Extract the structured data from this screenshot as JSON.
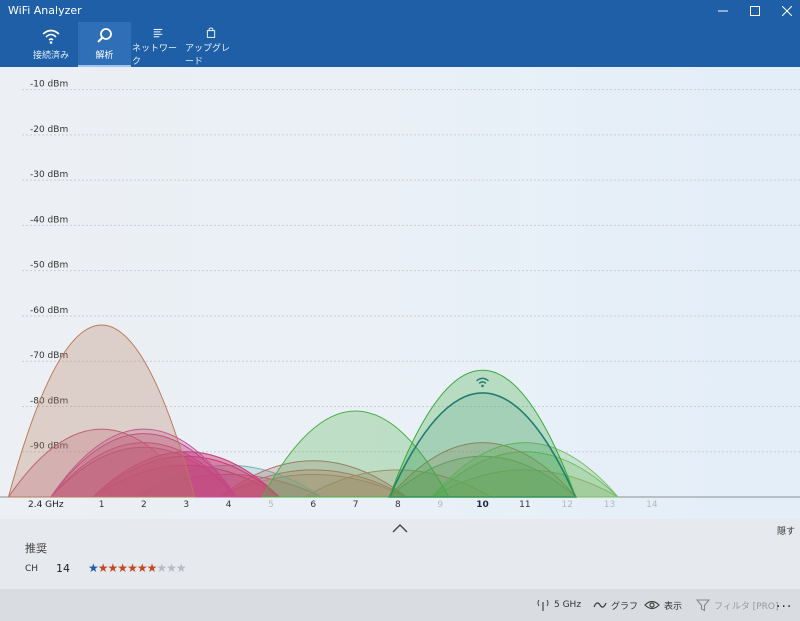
{
  "window": {
    "title": "WiFi Analyzer"
  },
  "nav": {
    "tabs": [
      {
        "label": "接続済み",
        "icon": "wifi-icon"
      },
      {
        "label": "解析",
        "icon": "magnifier-icon"
      },
      {
        "label": "ネットワーク",
        "icon": "network-list-icon"
      },
      {
        "label": "アップグレード",
        "icon": "shopping-bag-icon"
      }
    ],
    "active_index": 1
  },
  "chart_data": {
    "type": "area",
    "band": "2.4 GHz",
    "y_axis": {
      "ticks": [
        "-10 dBm",
        "-20 dBm",
        "-30 dBm",
        "-40 dBm",
        "-50 dBm",
        "-60 dBm",
        "-70 dBm",
        "-80 dBm",
        "-90 dBm"
      ],
      "tick_values": [
        -10,
        -20,
        -30,
        -40,
        -50,
        -60,
        -70,
        -80,
        -90
      ],
      "range": [
        -100,
        -5
      ],
      "grid": true
    },
    "x_axis": {
      "channels": [
        "1",
        "2",
        "3",
        "4",
        "5",
        "6",
        "7",
        "8",
        "9",
        "10",
        "11",
        "12",
        "13",
        "14"
      ],
      "channel_values": [
        1,
        2,
        3,
        4,
        5,
        6,
        7,
        8,
        9,
        10,
        11,
        12,
        13,
        14
      ],
      "dim_channels": [
        5,
        9,
        12,
        13,
        14
      ],
      "bold_channels": [
        10
      ],
      "range": [
        -1.4,
        17.5
      ]
    },
    "networks": [
      {
        "channel": 1,
        "level": -62,
        "color": "#b87b5a"
      },
      {
        "channel": 1,
        "level": -85,
        "color": "#c2587a"
      },
      {
        "channel": 2,
        "level": -85,
        "color": "#c4509a"
      },
      {
        "channel": 2,
        "level": -86,
        "color": "#c0407a"
      },
      {
        "channel": 2,
        "level": -88,
        "color": "#c84470"
      },
      {
        "channel": 2,
        "level": -89,
        "color": "#c64878"
      },
      {
        "channel": 3,
        "level": -90,
        "color": "#c83c64"
      },
      {
        "channel": 3,
        "level": -91,
        "color": "#cc3860"
      },
      {
        "channel": 3,
        "level": -93,
        "color": "#c03858"
      },
      {
        "channel": 3,
        "level": -90,
        "color": "#c84488"
      },
      {
        "channel": 4,
        "level": -93,
        "color": "#7ab8b0"
      },
      {
        "channel": 4,
        "level": -95,
        "color": "#c8507a"
      },
      {
        "channel": 6,
        "level": -92,
        "color": "#b07070"
      },
      {
        "channel": 6,
        "level": -94,
        "color": "#c06a60"
      },
      {
        "channel": 6,
        "level": -95,
        "color": "#d07c6a"
      },
      {
        "channel": 7,
        "level": -81,
        "color": "#4cb048"
      },
      {
        "channel": 8,
        "level": -94,
        "color": "#b88a70"
      },
      {
        "channel": 10,
        "level": -72,
        "color": "#3aa83a"
      },
      {
        "channel": 10,
        "level": -77,
        "color": "#1a6e86",
        "connected": true
      },
      {
        "channel": 10,
        "level": -88,
        "color": "#b27c60"
      },
      {
        "channel": 10,
        "level": -91,
        "color": "#60b060"
      },
      {
        "channel": 11,
        "level": -88,
        "color": "#78c068"
      },
      {
        "channel": 11,
        "level": -90,
        "color": "#70c060"
      },
      {
        "channel": 11,
        "level": -94,
        "color": "#90a870"
      }
    ]
  },
  "panel": {
    "hide_label": "隠す",
    "title": "推奨",
    "ch_label": "CH",
    "ch_value": "14",
    "rating": 7,
    "rating_max": 10,
    "star_colors": {
      "best": "#1f5da6",
      "filled": "#c24a22",
      "empty": "#b8bcc2"
    }
  },
  "toolbar": {
    "band": "5 GHz",
    "graph": "グラフ",
    "view": "表示",
    "filter": "フィルタ [PRO]",
    "more": "..."
  },
  "colors": {
    "accent": "#1e5fa8",
    "active_tab": "#2e6fb8"
  }
}
